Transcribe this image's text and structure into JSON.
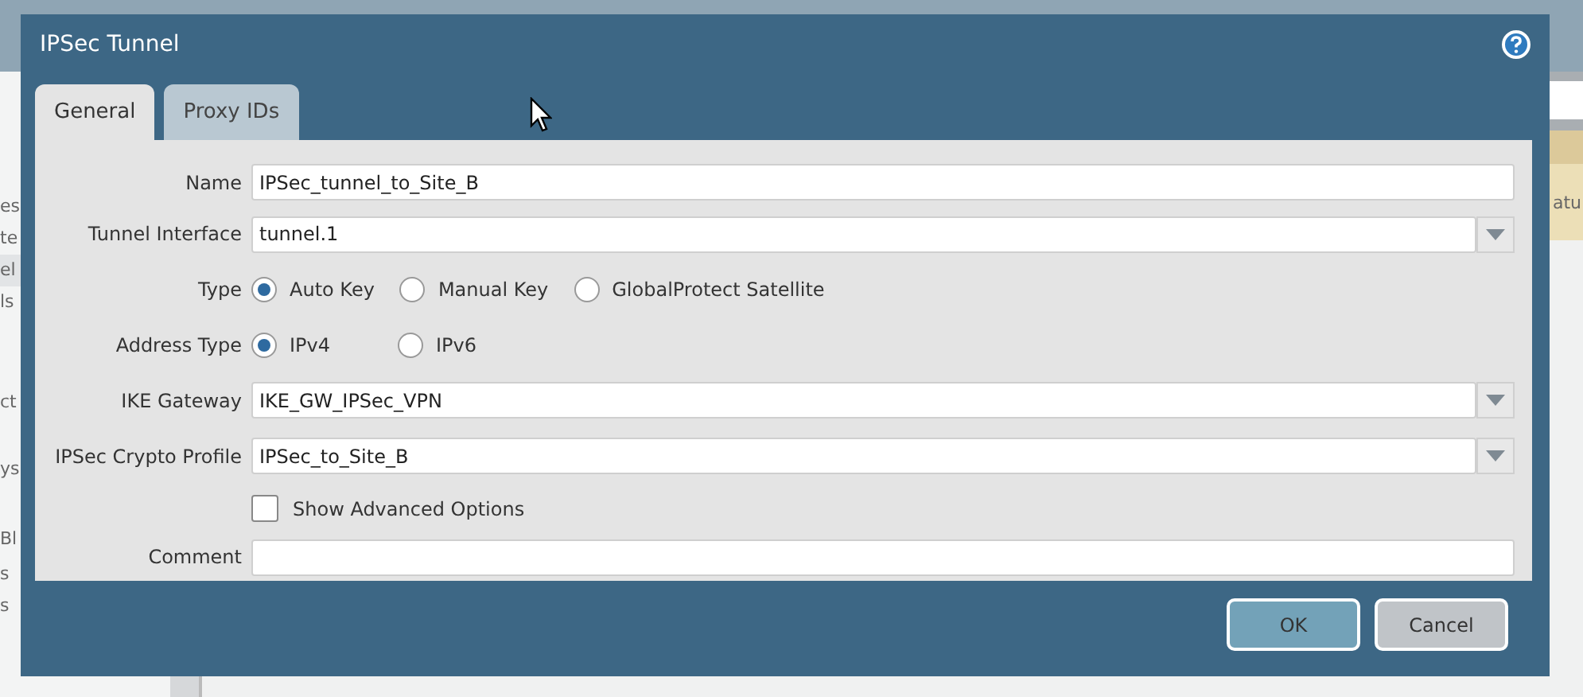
{
  "background": {
    "sidebar_fragments": [
      {
        "text": "es",
        "selected": false
      },
      {
        "text": "te",
        "selected": false
      },
      {
        "text": "el",
        "selected": true
      },
      {
        "text": "ls",
        "selected": false
      },
      {
        "text": "ct",
        "selected": false
      },
      {
        "text": "ys",
        "selected": false
      },
      {
        "text": "Bl",
        "selected": false
      },
      {
        "text": "s",
        "selected": false
      },
      {
        "text": "s",
        "selected": false
      }
    ],
    "right_fragment": "atu"
  },
  "dialog": {
    "title": "IPSec Tunnel",
    "tabs": [
      {
        "label": "General",
        "selected": true
      },
      {
        "label": "Proxy IDs",
        "selected": false
      }
    ],
    "fields": [
      {
        "kind": "text",
        "label": "Name",
        "value": "IPSec_tunnel_to_Site_B"
      },
      {
        "kind": "dropdown",
        "label": "Tunnel Interface",
        "value": "tunnel.1"
      },
      {
        "kind": "radio",
        "label": "Type",
        "options": [
          {
            "label": "Auto Key",
            "selected": true
          },
          {
            "label": "Manual Key",
            "selected": false
          },
          {
            "label": "GlobalProtect Satellite",
            "selected": false
          }
        ]
      },
      {
        "kind": "radio",
        "label": "Address Type",
        "options": [
          {
            "label": "IPv4",
            "selected": true
          },
          {
            "label": "IPv6",
            "selected": false
          }
        ]
      },
      {
        "kind": "dropdown",
        "label": "IKE Gateway",
        "value": "IKE_GW_IPSec_VPN"
      },
      {
        "kind": "dropdown",
        "label": "IPSec Crypto Profile",
        "value": "IPSec_to_Site_B"
      },
      {
        "kind": "checkbox",
        "label": "Show Advanced Options",
        "checked": false
      },
      {
        "kind": "text",
        "label": "Comment"
      }
    ],
    "buttons": [
      {
        "label": "OK",
        "kind": "primary"
      },
      {
        "label": "Cancel",
        "kind": "secondary"
      }
    ]
  }
}
